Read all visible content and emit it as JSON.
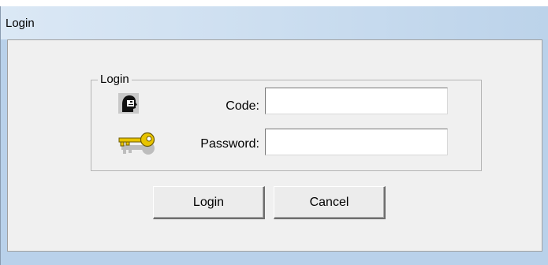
{
  "window": {
    "title": "Login"
  },
  "group": {
    "legend": "Login"
  },
  "fields": {
    "code": {
      "label": "Code:",
      "value": "",
      "icon": "user-head-icon"
    },
    "password": {
      "label": "Password:",
      "value": "",
      "icon": "key-icon"
    }
  },
  "buttons": {
    "login": "Login",
    "cancel": "Cancel"
  },
  "colors": {
    "window_frame": "#b9d1ea",
    "client_background": "#f0f0f0",
    "key_gold": "#e8c400"
  }
}
